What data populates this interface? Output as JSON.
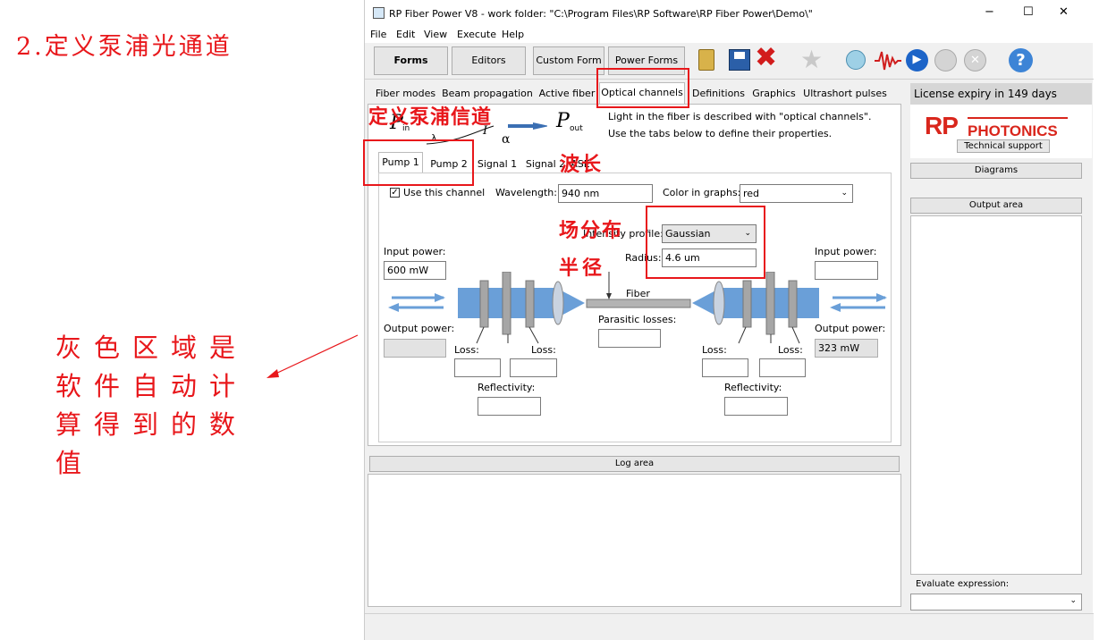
{
  "annotations": {
    "heading": "2.定义泵浦光通道",
    "define_channel": "定义泵浦信道",
    "wavelength": "波长",
    "field_dist": "场分布",
    "radius": "半径",
    "gray_area_l1": "灰色区域是",
    "gray_area_l2": "软件自动计",
    "gray_area_l3": "算得到的数",
    "gray_area_l4": "值"
  },
  "window": {
    "title": "RP Fiber Power V8 - work folder: \"C:\\Program Files\\RP Software\\RP Fiber Power\\Demo\\\"",
    "minimize": "−",
    "maximize": "☐",
    "close": "✕"
  },
  "menu": [
    "File",
    "Edit",
    "View",
    "Execute",
    "Help"
  ],
  "toolbar": {
    "forms": "Forms",
    "editors": "Editors",
    "custom_form": "Custom Form",
    "power_forms": "Power Forms"
  },
  "main_tabs": [
    "Fiber modes",
    "Beam propagation",
    "Active fiber",
    "Optical channels",
    "Definitions",
    "Graphics",
    "Ultrashort pulses"
  ],
  "intro": {
    "line1": "Light in the fiber is described with \"optical channels\".",
    "line2": "Use the tabs below to define their properties.",
    "p_in": "P",
    "p_in_sub": "in",
    "p_out": "P",
    "p_out_sub": "out",
    "lambda": "λ",
    "i": "I",
    "alpha": "α"
  },
  "sub_tabs": [
    "Pump 1",
    "Pump 2",
    "Signal 1",
    "Signal 2",
    "ASE"
  ],
  "channel": {
    "use_channel": "Use this channel",
    "wavelength_label": "Wavelength:",
    "wavelength_value": "940 nm",
    "color_label": "Color in graphs:",
    "color_value": "red",
    "intensity_label": "Intensity profile:",
    "intensity_value": "Gaussian",
    "radius_label": "Radius:",
    "radius_value": "4.6 um",
    "input_power_label": "Input power:",
    "input_power_left": "600 mW",
    "input_power_right": "",
    "output_power_label": "Output power:",
    "output_power_left": "",
    "output_power_right": "323 mW",
    "fiber_label": "Fiber",
    "parasitic_label": "Parasitic losses:",
    "loss_label": "Loss:",
    "reflectivity_label": "Reflectivity:"
  },
  "log_area": "Log area",
  "right_panel": {
    "license": "License expiry in 149 days",
    "logo_rp": "RP",
    "logo_photonics": "PHOTONICS",
    "tech_support": "Technical support",
    "diagrams": "Diagrams",
    "output_area": "Output area",
    "evaluate": "Evaluate expression:"
  },
  "colors": {
    "annotation_red": "#e8171b",
    "beam_blue": "#6a9fd8",
    "window_bg": "#f0f0f0"
  }
}
